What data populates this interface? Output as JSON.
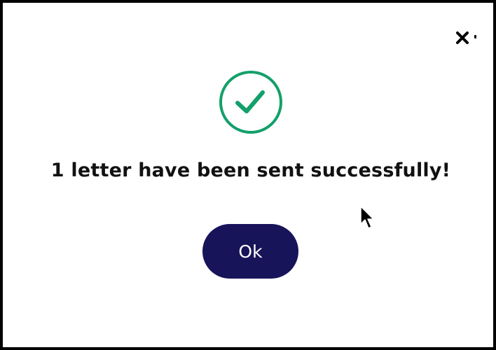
{
  "dialog": {
    "message": "1 letter have been sent successfully!",
    "ok_label": "Ok",
    "close_icon": "close-icon",
    "status_icon": "check-circle-icon"
  },
  "colors": {
    "success": "#13a06a",
    "button_bg": "#18145a",
    "button_text": "#ffffff",
    "text": "#111111"
  }
}
